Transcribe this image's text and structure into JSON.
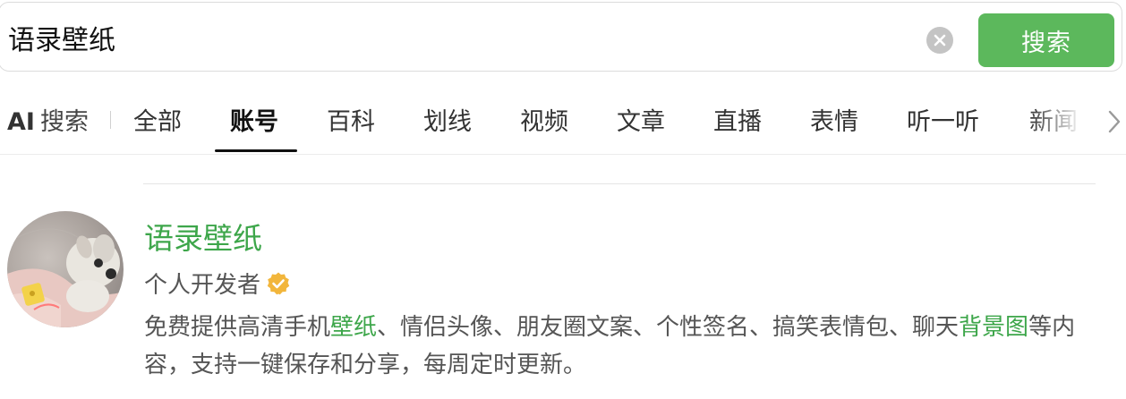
{
  "search": {
    "query": "语录壁纸",
    "button_label": "搜索"
  },
  "tabs": {
    "ai": {
      "prefix": "AI",
      "label": "搜索"
    },
    "items": [
      {
        "label": "全部"
      },
      {
        "label": "账号",
        "active": true
      },
      {
        "label": "百科"
      },
      {
        "label": "划线"
      },
      {
        "label": "视频"
      },
      {
        "label": "文章"
      },
      {
        "label": "直播"
      },
      {
        "label": "表情"
      },
      {
        "label": "听一听"
      },
      {
        "label": "新闻"
      }
    ]
  },
  "result": {
    "name": "语录壁纸",
    "account_type": "个人开发者",
    "desc": {
      "part1": "免费提供高清手机",
      "hl1": "壁纸",
      "part2": "、情侣头像、朋友圈文案、个性签名、搞笑表情包、聊天",
      "hl2": "背景图",
      "part3": "等内容，支持一键保存和分享，每周定时更新。"
    }
  },
  "colors": {
    "accent_green": "#5cb85c",
    "link_green": "#3da64a",
    "verified_gold": "#f2b63c"
  },
  "icons": {
    "clear": "close-circle-icon",
    "more": "chevron-right-icon",
    "verified": "verified-badge-icon"
  }
}
